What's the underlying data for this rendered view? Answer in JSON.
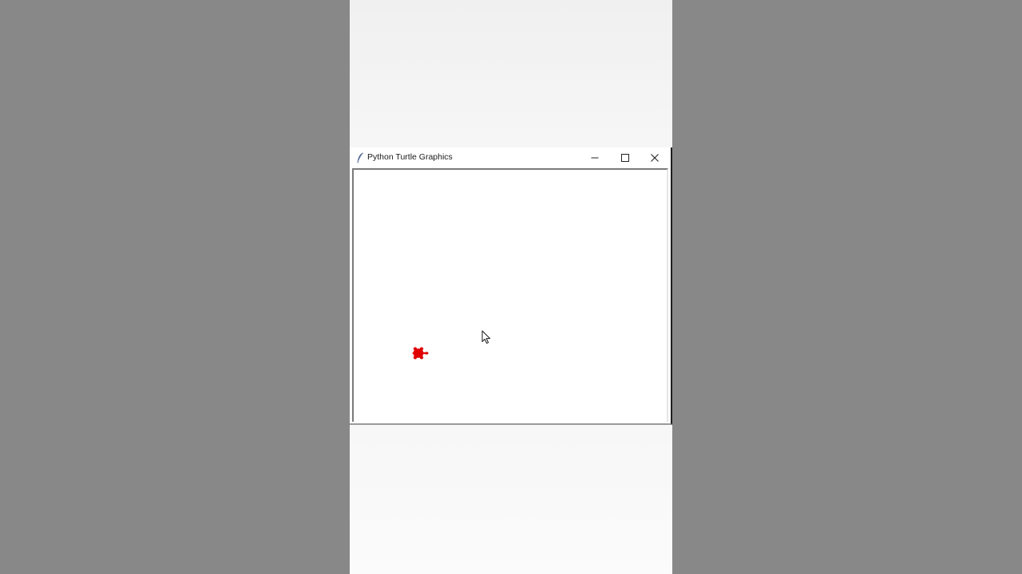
{
  "window": {
    "title": "Python Turtle Graphics",
    "icon": "feather-icon",
    "controls": {
      "minimize_icon": "minimize-icon",
      "maximize_icon": "maximize-icon",
      "close_icon": "close-icon"
    }
  },
  "canvas": {
    "background": "#ffffff",
    "turtle": {
      "shape": "turtle",
      "color": "#e00000",
      "heading": "east"
    },
    "cursor_icon": "mouse-pointer-icon"
  },
  "colors": {
    "backdrop": "#888888",
    "turtle": "#e00000"
  }
}
